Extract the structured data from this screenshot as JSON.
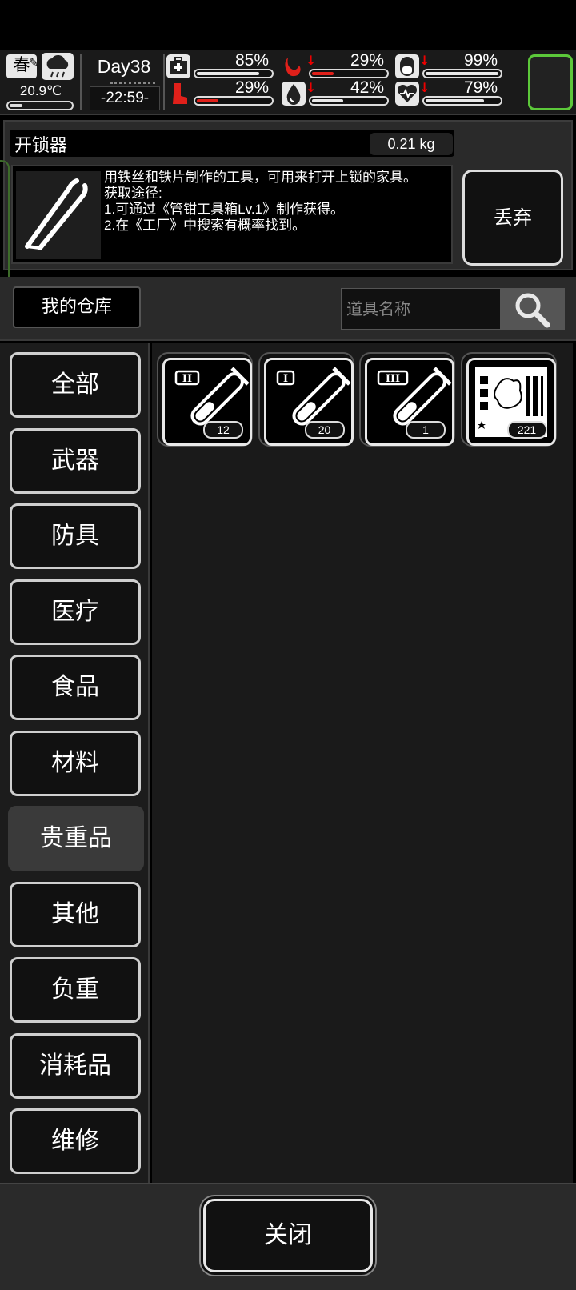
{
  "status": {
    "season": "春",
    "temperature": "20.9℃",
    "temperature_level": 0.2,
    "day": "Day38",
    "time": "-22:59-",
    "stats": [
      {
        "icon": "first-aid-icon",
        "value": "85%",
        "level": 0.85,
        "declining": false,
        "color": "#e8e8e8"
      },
      {
        "icon": "stomach-icon",
        "value": "29%",
        "level": 0.29,
        "declining": true,
        "color": "#e0201a"
      },
      {
        "icon": "pill-icon",
        "value": "99%",
        "level": 0.99,
        "declining": true,
        "color": "#e8e8e8"
      },
      {
        "icon": "leg-injury-icon",
        "value": "29%",
        "level": 0.29,
        "declining": false,
        "color": "#e0201a"
      },
      {
        "icon": "water-drop-icon",
        "value": "42%",
        "level": 0.42,
        "declining": true,
        "color": "#e8e8e8"
      },
      {
        "icon": "heart-icon",
        "value": "79%",
        "level": 0.79,
        "declining": true,
        "color": "#e8e8e8"
      }
    ]
  },
  "item": {
    "name": "开锁器",
    "weight": "0.21 kg",
    "description": "用铁丝和铁片制作的工具，可用来打开上锁的家具。\n获取途径:\n1.可通过《管钳工具箱Lv.1》制作获得。\n2.在《工厂》中搜索有概率找到。",
    "discard_label": "丢弃"
  },
  "warehouse": {
    "label": "我的仓库",
    "search_placeholder": "道具名称"
  },
  "categories": [
    {
      "label": "全部"
    },
    {
      "label": "武器"
    },
    {
      "label": "防具"
    },
    {
      "label": "医疗"
    },
    {
      "label": "食品"
    },
    {
      "label": "材料"
    },
    {
      "label": "贵重品",
      "selected": true
    },
    {
      "label": "其他"
    },
    {
      "label": "负重"
    },
    {
      "label": "消耗品"
    },
    {
      "label": "维修"
    }
  ],
  "items": [
    {
      "icon": "test-tube-ii-icon",
      "tier": "II",
      "count": "12"
    },
    {
      "icon": "test-tube-i-icon",
      "tier": "I",
      "count": "20"
    },
    {
      "icon": "test-tube-iii-icon",
      "tier": "III",
      "count": "1"
    },
    {
      "icon": "zombie-card-icon",
      "tier": "",
      "count": "221"
    }
  ],
  "close_label": "关闭",
  "colors": {
    "accent_green": "#5cc83a",
    "warning_red": "#e0201a"
  }
}
